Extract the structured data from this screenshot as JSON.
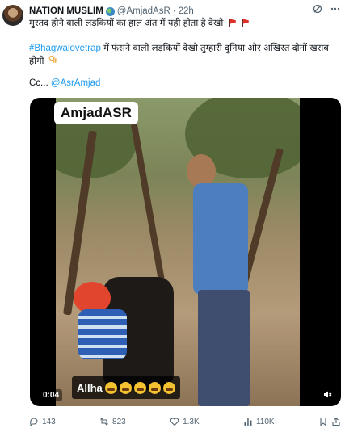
{
  "tweet": {
    "author_name": "NATION MUSLIM",
    "author_badge_icon": "globe-emoji-icon",
    "handle": "@AmjadAsR",
    "separator": "·",
    "time": "22h",
    "line1": "मुरतद होने वाली लड़कियों का हाल अंत में यही होता है देखो",
    "line1_icons": [
      "red-flag-icon",
      "red-flag-icon"
    ],
    "hashtag": "#Bhagwalovetrap",
    "line2_rest": " में फंसने वाली लड़कियों देखो तुम्हारी दुनिया और अखिरत दोनों खराब होगी",
    "line2_icon": "ok-hand-icon",
    "cc_prefix": "Cc... ",
    "cc_mention": "@AsrAmjad"
  },
  "media": {
    "watermark": "AmjadASR",
    "caption_text": "Allha",
    "caption_icons": [
      "crying-face-icon",
      "crying-face-icon",
      "crying-face-icon",
      "crying-face-icon",
      "crying-face-icon"
    ],
    "timecode": "0:04",
    "mute_icon": "mute-icon"
  },
  "actions": {
    "replies": "143",
    "retweets": "823",
    "likes": "1.3K",
    "views": "110K"
  },
  "colors": {
    "link": "#1d9bf0",
    "text": "#0f1419",
    "secondary": "#536471"
  }
}
